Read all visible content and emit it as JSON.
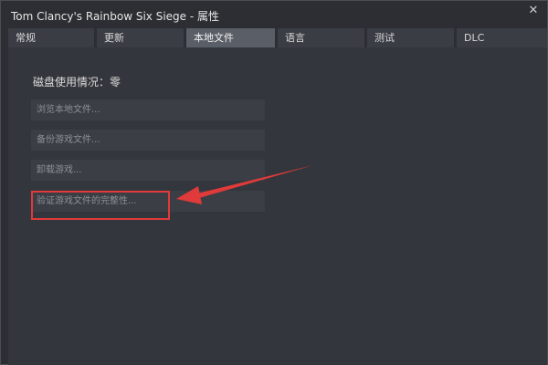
{
  "window": {
    "title": "Tom Clancy's Rainbow Six Siege - 属性",
    "close_glyph": "✕"
  },
  "tabs": [
    {
      "label": "常规",
      "active": false
    },
    {
      "label": "更新",
      "active": false
    },
    {
      "label": "本地文件",
      "active": true
    },
    {
      "label": "语言",
      "active": false
    },
    {
      "label": "测试",
      "active": false
    },
    {
      "label": "DLC",
      "active": false
    }
  ],
  "local_files": {
    "disk_usage": "磁盘使用情况：零",
    "buttons": {
      "browse": "浏览本地文件...",
      "backup": "备份游戏文件...",
      "uninstall": "卸载游戏...",
      "verify": "验证游戏文件的完整性..."
    }
  },
  "annotation": {
    "color": "#e03a3a",
    "target": "verify"
  }
}
